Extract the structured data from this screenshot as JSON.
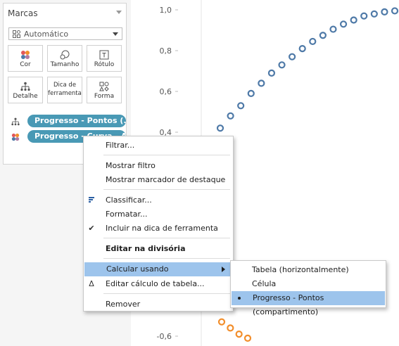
{
  "marks_card": {
    "title": "Marcas",
    "mark_type": "Automático",
    "buttons": {
      "color": "Cor",
      "size": "Tamanho",
      "label": "Rótulo",
      "detail": "Detalhe",
      "tooltip_line1": "Dica de",
      "tooltip_line2": "ferramenta",
      "shape": "Forma"
    },
    "pills": [
      {
        "label": "Progresso - Pontos (..",
        "icon": "detail-icon"
      },
      {
        "label": "Progresso - Curva - A",
        "icon": "color-icon"
      }
    ]
  },
  "chart": {
    "y_tick_labels": [
      "1,0",
      "0,8",
      "0,6",
      "0,4",
      "-0,6"
    ],
    "series_colors": {
      "blue": "#4e79a7",
      "orange": "#f28e2b"
    }
  },
  "chart_data": {
    "type": "scatter",
    "y_ticks": [
      1.0,
      0.8,
      0.6,
      0.4,
      -0.6
    ],
    "series": [
      {
        "values": [
          0.42,
          0.48,
          0.53,
          0.59,
          0.64,
          0.69,
          0.73,
          0.77,
          0.81,
          0.845,
          0.875,
          0.905,
          0.93,
          0.95,
          0.97,
          0.98,
          0.99,
          0.995
        ],
        "color": "#4e79a7"
      },
      {
        "values": [
          -0.53,
          -0.56,
          -0.59,
          -0.61
        ],
        "color": "#f28e2b"
      }
    ]
  },
  "context_menu": {
    "filter": "Filtrar...",
    "show_filter": "Mostrar filtro",
    "show_highlighter": "Mostrar marcador de destaque",
    "sort": "Classificar...",
    "format": "Formatar...",
    "include_in_tooltip": "Incluir na dica de ferramenta",
    "edit_in_shelf": "Editar na divisória",
    "compute_using": "Calcular usando",
    "edit_table_calc": "Editar cálculo de tabela...",
    "remove": "Remover"
  },
  "submenu": {
    "items": [
      "Tabela (horizontalmente)",
      "Célula",
      "Progresso - Pontos (compartimento)"
    ],
    "selected": "Progresso - Pontos (compartimento)"
  },
  "colors": {
    "highlight": "#9dc4ec",
    "pill": "#4999b5"
  }
}
